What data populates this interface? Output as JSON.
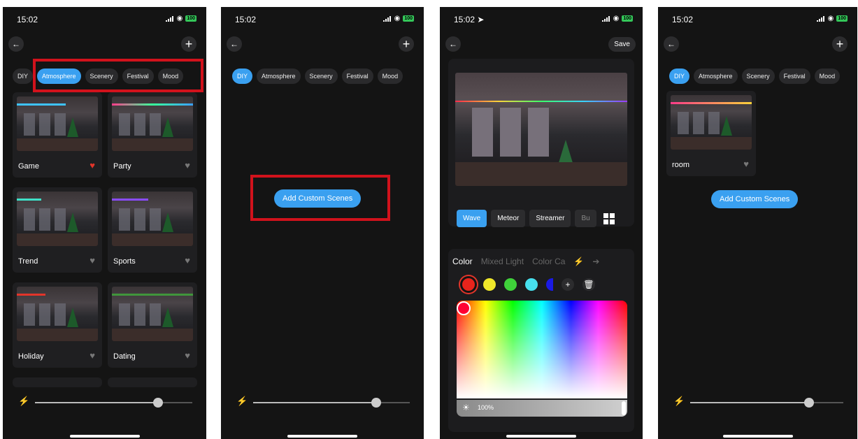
{
  "status": {
    "time": "15:02",
    "battery": "100"
  },
  "tabs": [
    "DIY",
    "Atmosphere",
    "Scenery",
    "Festival",
    "Mood"
  ],
  "screen1": {
    "active_tab": "Atmosphere",
    "cards": [
      {
        "label": "Game",
        "favorite": true
      },
      {
        "label": "Party",
        "favorite": false
      },
      {
        "label": "Trend",
        "favorite": false
      },
      {
        "label": "Sports",
        "favorite": false
      },
      {
        "label": "Holiday",
        "favorite": false
      },
      {
        "label": "Dating",
        "favorite": false
      }
    ],
    "brightness": 0.8
  },
  "screen2": {
    "active_tab": "DIY",
    "add_button": "Add Custom Scenes",
    "brightness": 0.8
  },
  "screen3": {
    "save": "Save",
    "modes": [
      "Wave",
      "Meteor",
      "Streamer",
      "Bu"
    ],
    "color_tabs": [
      "Color",
      "Mixed Light",
      "Color Ca"
    ],
    "swatches": [
      "#e8241c",
      "#f0e82a",
      "#3fd13a",
      "#47e0ee",
      "#1a1ae6"
    ],
    "brightness_label": "100%"
  },
  "screen4": {
    "active_tab": "DIY",
    "card_label": "room",
    "add_button": "Add Custom Scenes",
    "brightness": 0.8
  },
  "colors": {
    "accent": "#3aa0f0",
    "highlight_box": "#d1121c",
    "heart_on": "#e2352a"
  }
}
